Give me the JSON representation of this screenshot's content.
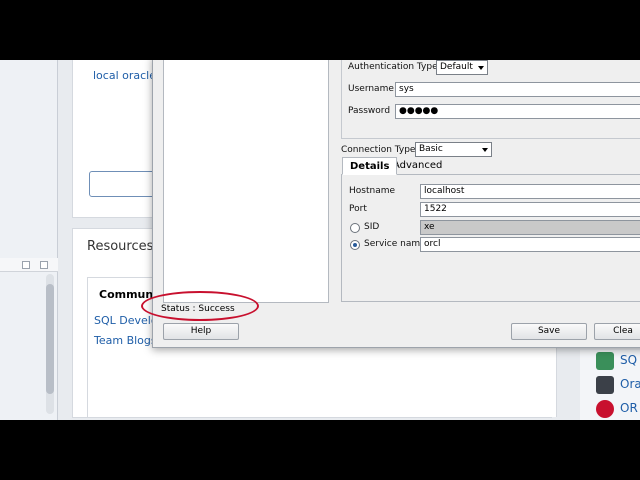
{
  "background": {
    "start_link": "local oracle",
    "resources_title": "Resources",
    "community_tab": "Communit",
    "links": [
      "SQL Develop",
      "Team Blogs a"
    ],
    "right_items": [
      {
        "label": "SQ",
        "icon": "sql-icon",
        "color": "#3a8f5a"
      },
      {
        "label": "Ora",
        "icon": "terminal-icon",
        "color": "#3b4048"
      },
      {
        "label": "OR",
        "icon": "oracle-icon",
        "color": "#c8102e"
      }
    ]
  },
  "dialog": {
    "auth_type_label": "Authentication Type",
    "auth_type_value": "Default",
    "username_label": "Username",
    "username_value": "sys",
    "password_label": "Password",
    "password_value": "●●●●●",
    "connection_type_label": "Connection Type",
    "connection_type_value": "Basic",
    "tabs": [
      "Details",
      "Advanced"
    ],
    "hostname_label": "Hostname",
    "hostname_value": "localhost",
    "port_label": "Port",
    "port_value": "1522",
    "sid_label": "SID",
    "sid_value": "xe",
    "service_label": "Service name",
    "service_value": "orcl",
    "status": "Status : Success",
    "buttons": {
      "help": "Help",
      "save": "Save",
      "clear": "Clea"
    }
  }
}
